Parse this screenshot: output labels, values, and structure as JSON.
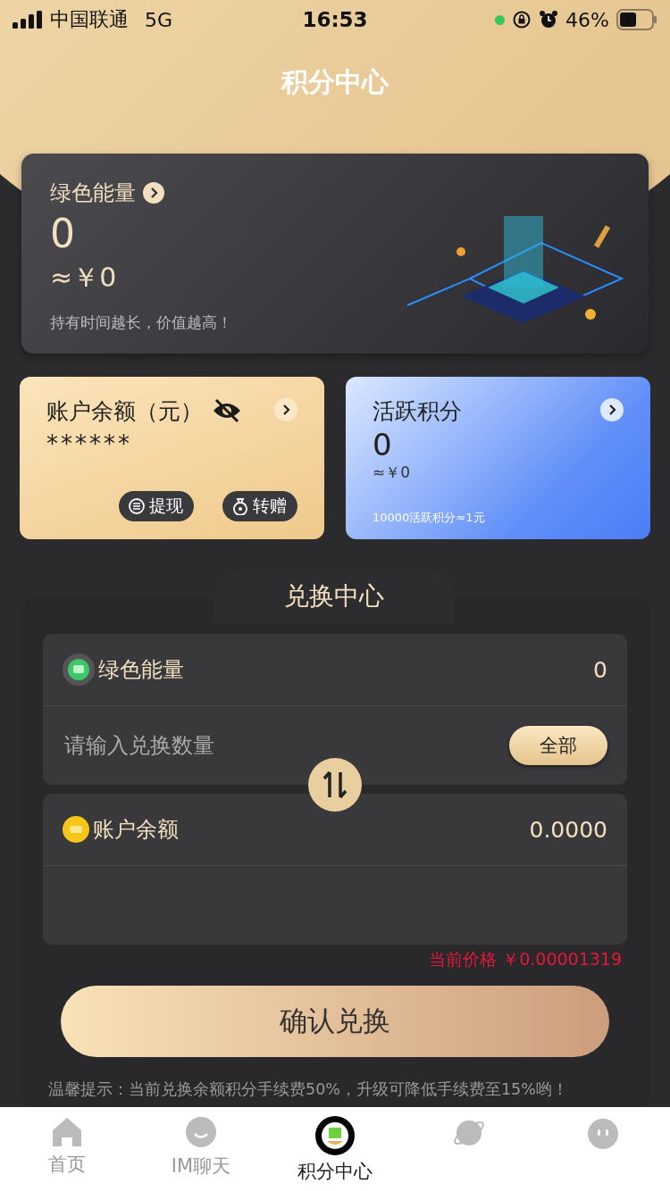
{
  "status_bar": {
    "carrier": "中国联通",
    "network": "5G",
    "time": "16:53",
    "battery": "46%"
  },
  "header": {
    "title": "积分中心"
  },
  "energy_card": {
    "title": "绿色能量",
    "value": "0",
    "approx": "≈￥0",
    "tip": "持有时间越长，价值越高！"
  },
  "balance_card": {
    "title": "账户余额（元）",
    "value": "******",
    "buttons": [
      {
        "label": "提现",
        "kind": "withdraw"
      },
      {
        "label": "转赠",
        "kind": "gift"
      }
    ]
  },
  "active_card": {
    "title": "活跃积分",
    "value": "0",
    "approx": "≈￥0",
    "rate": "10000活跃积分≈1元"
  },
  "exchange": {
    "title": "兑换中心",
    "from": {
      "name": "绿色能量",
      "amount": "0",
      "placeholder": "请输入兑换数量",
      "all_button": "全部"
    },
    "to": {
      "name": "账户余额",
      "amount": "0.0000"
    },
    "price": "当前价格 ￥0.00001319",
    "confirm": "确认兑换",
    "notice": "温馨提示：当前兑换余额积分手续费50%，升级可降低手续费至15%哟！"
  },
  "tab_bar": [
    {
      "label": "首页",
      "kind": "home",
      "selected": false
    },
    {
      "label": "IM聊天",
      "kind": "chat",
      "selected": false
    },
    {
      "label": "积分中心",
      "kind": "points",
      "selected": true
    },
    {
      "kind": "planet",
      "selected": false
    },
    {
      "kind": "face",
      "selected": false
    }
  ]
}
